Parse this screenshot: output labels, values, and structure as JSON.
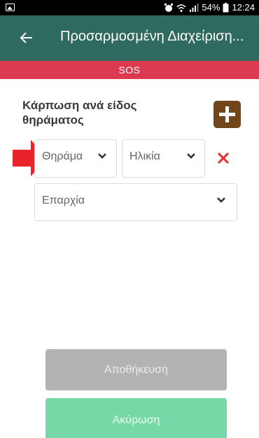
{
  "status_bar": {
    "battery": "54%",
    "time": "12:24"
  },
  "app_bar": {
    "title": "Προσαρμοσμένη Διαχείριση..."
  },
  "sos_bar": {
    "label": "SOS"
  },
  "section": {
    "title": "Κάρπωση ανά είδος θηράματος"
  },
  "form": {
    "game_select": {
      "value": "Θηράμα"
    },
    "age_select": {
      "value": "Ηλικία"
    },
    "region_select": {
      "value": "Επαρχία"
    }
  },
  "actions": {
    "save_label": "Αποθήκευση",
    "cancel_label": "Ακύρωση"
  },
  "colors": {
    "app_bar": "#2e6a5d",
    "sos": "#dc3a50",
    "add_button": "#714618",
    "remove": "#e53935",
    "save_disabled": "#b3b3b3",
    "cancel": "#76d8a6"
  }
}
